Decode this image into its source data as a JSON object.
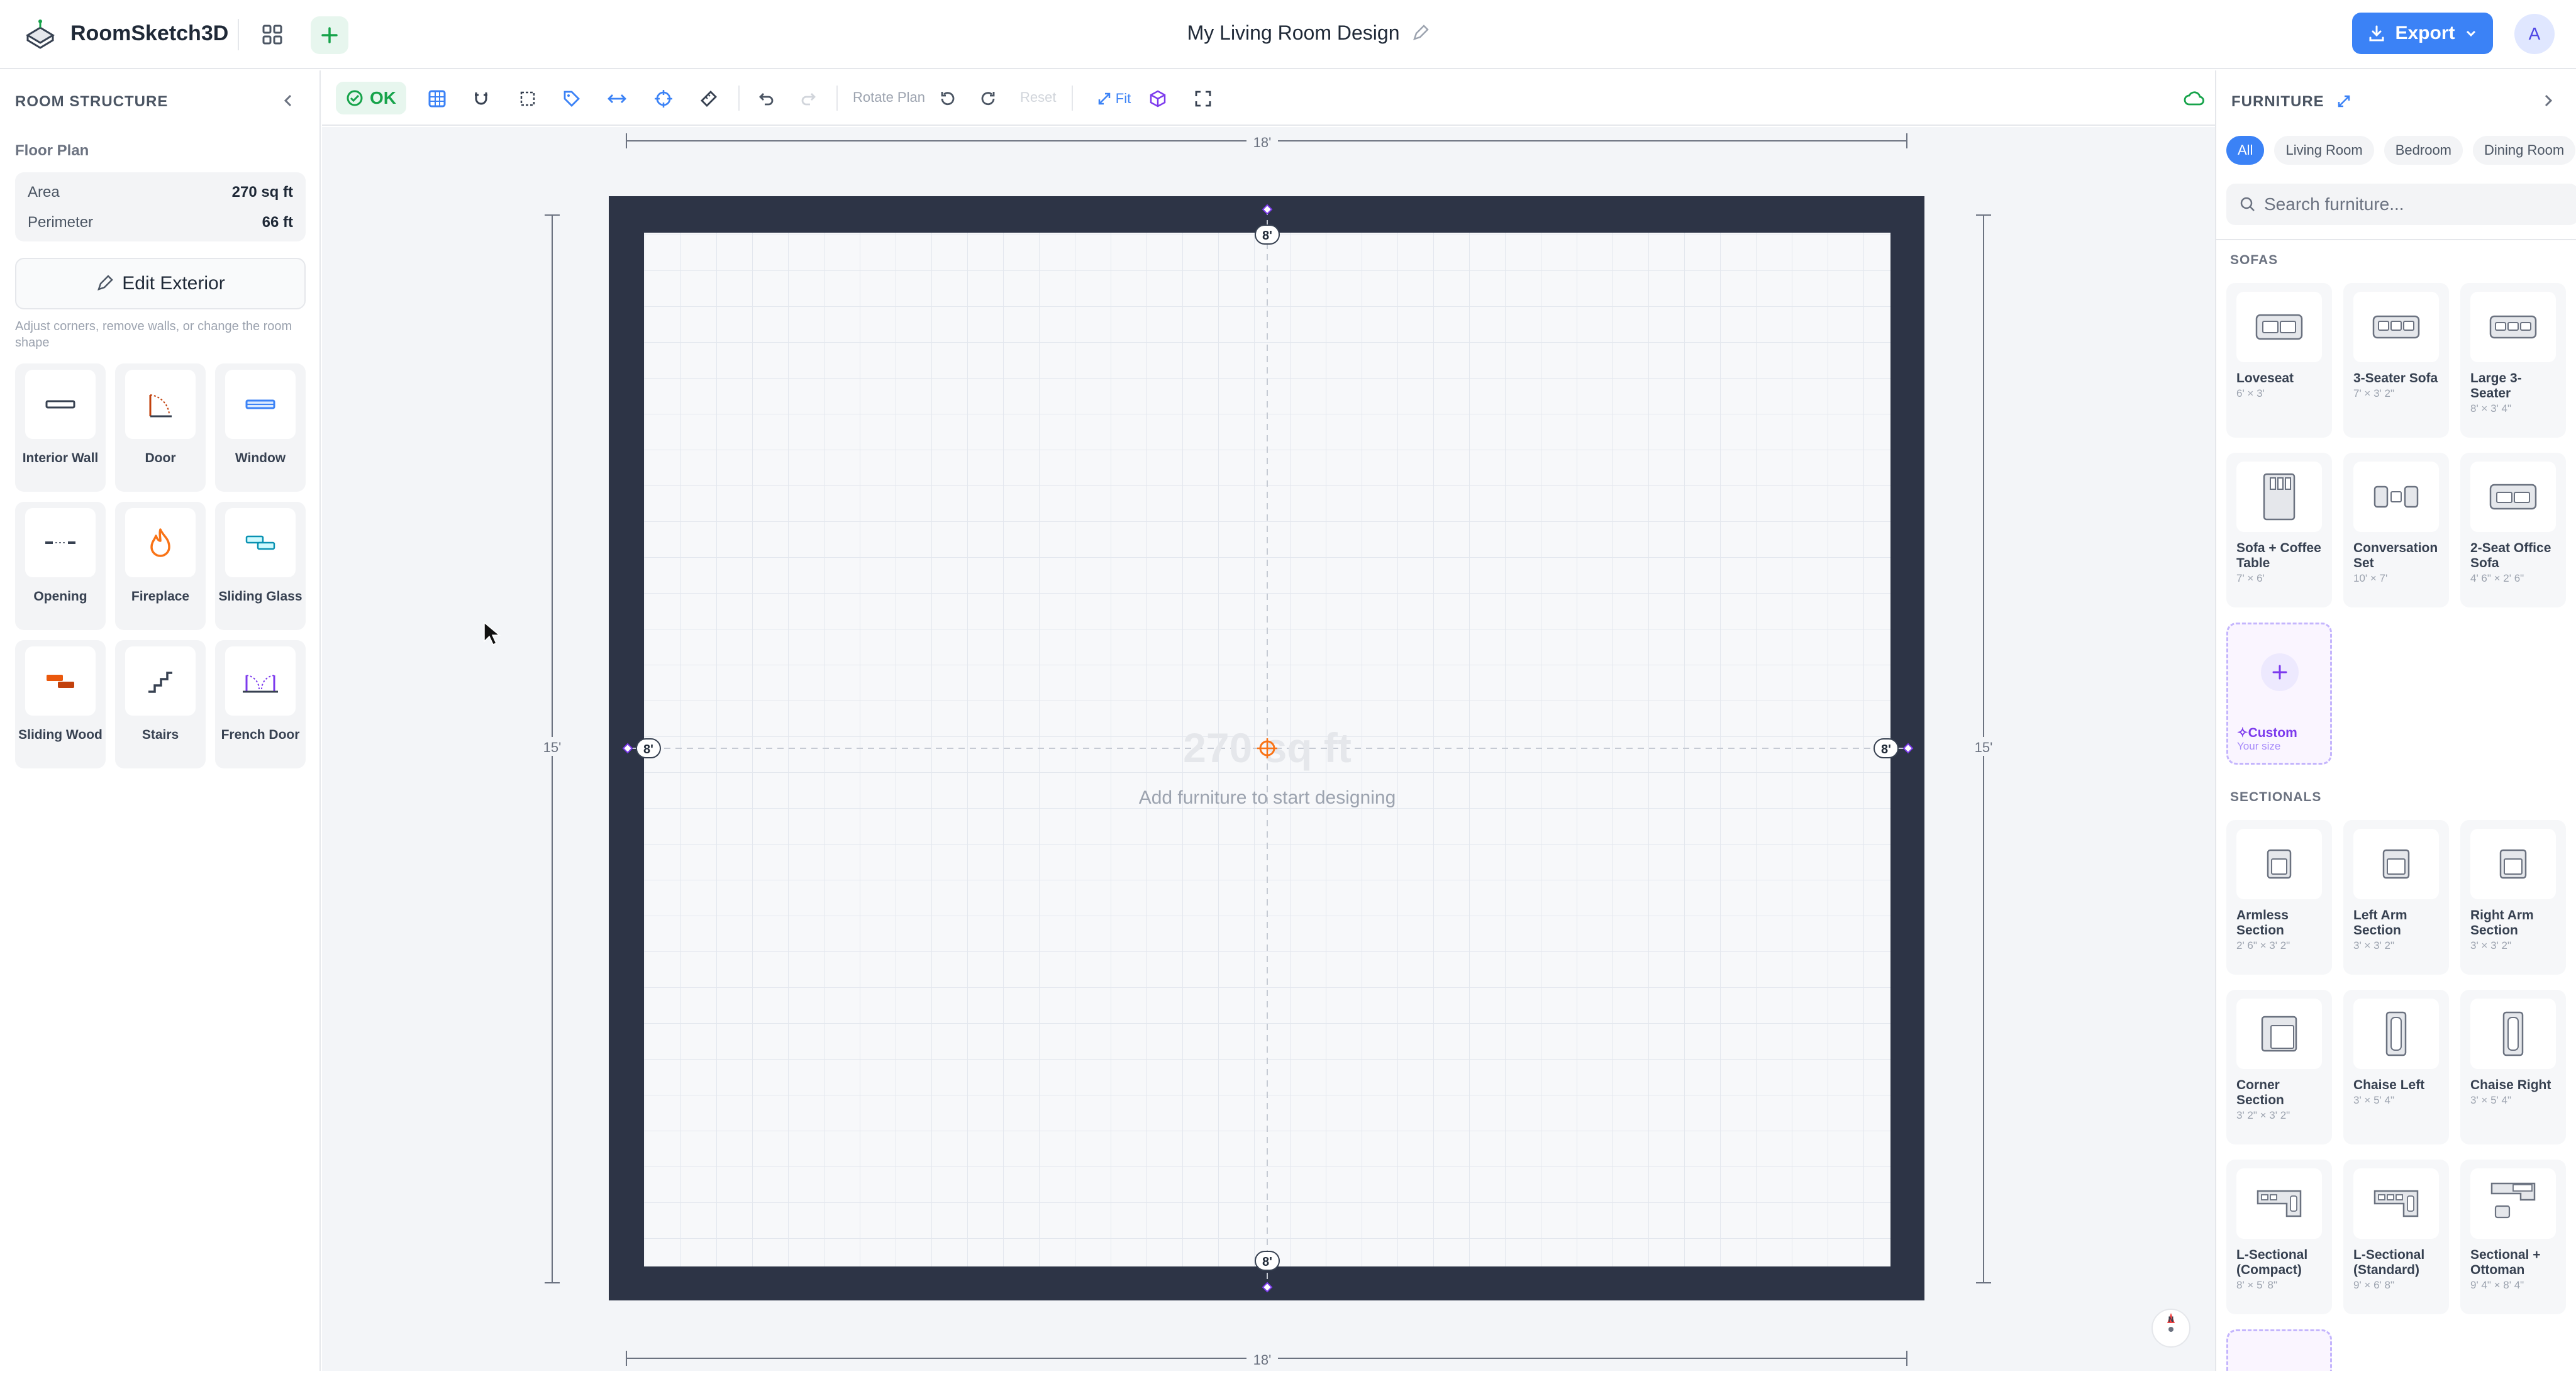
{
  "app": {
    "name": "RoomSketch3D"
  },
  "header": {
    "doc_title": "My Living Room Design",
    "export_label": "Export",
    "avatar_initial": "A"
  },
  "left_panel": {
    "title": "ROOM STRUCTURE",
    "floor_plan_label": "Floor Plan",
    "stats": [
      {
        "label": "Area",
        "value": "270 sq ft"
      },
      {
        "label": "Perimeter",
        "value": "66 ft"
      }
    ],
    "edit_exterior_label": "Edit Exterior",
    "hint": "Adjust corners, remove walls, or change the room shape",
    "elements": [
      {
        "label": "Interior Wall",
        "icon": "interior-wall-icon"
      },
      {
        "label": "Door",
        "icon": "door-icon"
      },
      {
        "label": "Window",
        "icon": "window-icon"
      },
      {
        "label": "Opening",
        "icon": "opening-icon"
      },
      {
        "label": "Fireplace",
        "icon": "fireplace-icon"
      },
      {
        "label": "Sliding Glass",
        "icon": "sliding-glass-icon"
      },
      {
        "label": "Sliding Wood",
        "icon": "sliding-wood-icon"
      },
      {
        "label": "Stairs",
        "icon": "stairs-icon"
      },
      {
        "label": "French Door",
        "icon": "french-door-icon"
      }
    ]
  },
  "toolbar": {
    "ok_label": "OK",
    "rotate_plan_label": "Rotate Plan",
    "reset_label": "Reset",
    "fit_label": "Fit"
  },
  "canvas": {
    "dim_top": "18'",
    "dim_bottom": "18'",
    "dim_left": "15'",
    "dim_right": "15'",
    "wall_top": "8'",
    "wall_bottom": "8'",
    "wall_left": "8'",
    "wall_right": "8'",
    "area_watermark": "270 sq ft",
    "empty_message": "Add furniture to start designing",
    "compass_label": "N"
  },
  "right_panel": {
    "title": "FURNITURE",
    "chips": [
      {
        "label": "All",
        "active": true
      },
      {
        "label": "Living Room"
      },
      {
        "label": "Bedroom"
      },
      {
        "label": "Dining Room"
      }
    ],
    "search_placeholder": "Search furniture...",
    "sections": [
      {
        "title": "SOFAS",
        "items": [
          {
            "name": "Loveseat",
            "dims": "6' × 3'"
          },
          {
            "name": "3-Seater Sofa",
            "dims": "7' × 3' 2\""
          },
          {
            "name": "Large 3-Seater",
            "dims": "8' × 3' 4\""
          },
          {
            "name": "Sofa + Coffee Table",
            "dims": "7' × 6'"
          },
          {
            "name": "Conversation Set",
            "dims": "10' × 7'"
          },
          {
            "name": "2-Seat Office Sofa",
            "dims": "4' 6\" × 2' 6\""
          }
        ],
        "custom": {
          "label": "Custom",
          "sub": "Your size"
        }
      },
      {
        "title": "SECTIONALS",
        "items": [
          {
            "name": "Armless Section",
            "dims": "2' 6\" × 3' 2\""
          },
          {
            "name": "Left Arm Section",
            "dims": "3' × 3' 2\""
          },
          {
            "name": "Right Arm Section",
            "dims": "3' × 3' 2\""
          },
          {
            "name": "Corner Section",
            "dims": "3' 2\" × 3' 2\""
          },
          {
            "name": "Chaise Left",
            "dims": "3' × 5' 4\""
          },
          {
            "name": "Chaise Right",
            "dims": "3' × 5' 4\""
          },
          {
            "name": "L-Sectional (Compact)",
            "dims": "8' × 5' 8\""
          },
          {
            "name": "L-Sectional (Standard)",
            "dims": "9' × 6' 8\""
          },
          {
            "name": "Sectional + Ottoman",
            "dims": "9' 4\" × 8' 4\""
          }
        ]
      }
    ]
  },
  "colors": {
    "accent": "#3b82f6",
    "ok_green": "#16a34a",
    "wall": "#2d3446",
    "canvas_bg": "#f3f5f8",
    "purple": "#7c3aed",
    "orange": "#f97316"
  }
}
